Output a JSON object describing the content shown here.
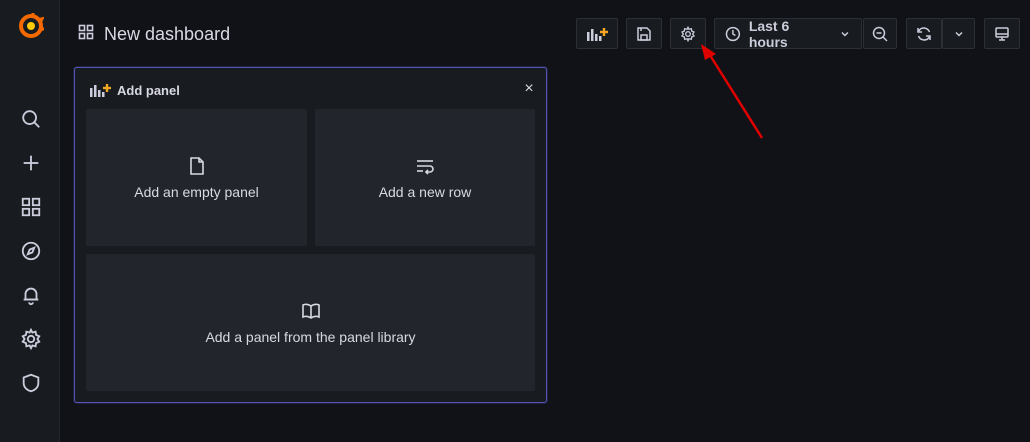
{
  "dashboard": {
    "title": "New dashboard"
  },
  "toolbar": {
    "time_range": "Last 6 hours",
    "icons": [
      "add-panel-icon",
      "save-icon",
      "settings-icon",
      "clock-icon",
      "chevron-down-icon",
      "zoom-out-icon",
      "refresh-icon",
      "chevron-down-icon",
      "tv-mode-icon"
    ]
  },
  "sidebar": {
    "items": [
      "search",
      "create",
      "dashboards",
      "explore",
      "alerting",
      "configuration",
      "server-admin"
    ]
  },
  "add_panel": {
    "header": "Add panel",
    "close": "×",
    "options": {
      "empty": "Add an empty panel",
      "row": "Add a new row",
      "library": "Add a panel from the panel library"
    }
  },
  "colors": {
    "background": "#111217",
    "sidebar": "#181b1f",
    "panel_border": "#5454b8",
    "option_bg": "#22252b",
    "accent_orange": "#f5a623",
    "annotation_arrow": "#e00000"
  }
}
